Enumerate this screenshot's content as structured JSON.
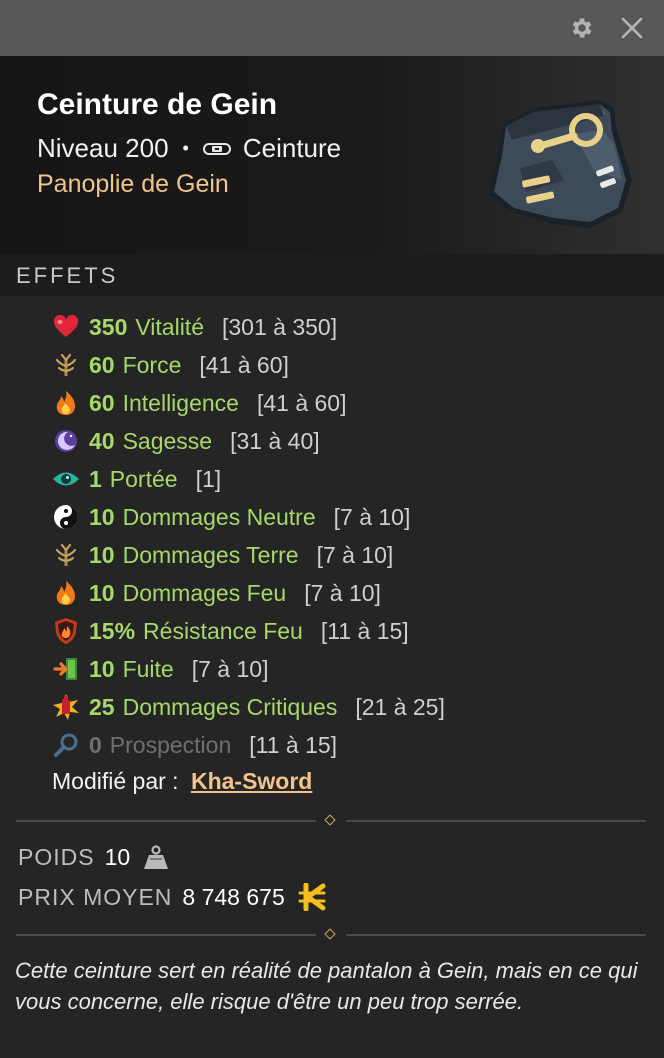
{
  "window": {
    "settings_icon": "gear-icon",
    "close_icon": "close-icon"
  },
  "item": {
    "name": "Ceinture de Gein",
    "level": "Niveau 200",
    "separator": "•",
    "type": "Ceinture",
    "type_icon": "belt-icon",
    "set": "Panoplie de Gein"
  },
  "effects_section": {
    "title": "EFFETS",
    "effects": [
      {
        "icon": "heart-icon",
        "value": "350",
        "name": "Vitalité",
        "range": "[301 à 350]"
      },
      {
        "icon": "earth-sprout-icon",
        "value": "60",
        "name": "Force",
        "range": "[41 à 60]"
      },
      {
        "icon": "fire-icon",
        "value": "60",
        "name": "Intelligence",
        "range": "[41 à 60]"
      },
      {
        "icon": "moon-icon",
        "value": "40",
        "name": "Sagesse",
        "range": "[31 à 40]"
      },
      {
        "icon": "eye-icon",
        "value": "1",
        "name": "Portée",
        "range": "[1]"
      },
      {
        "icon": "yin-yang-icon",
        "value": "10",
        "name": "Dommages Neutre",
        "range": "[7 à 10]"
      },
      {
        "icon": "earth-sprout-icon",
        "value": "10",
        "name": "Dommages Terre",
        "range": "[7 à 10]"
      },
      {
        "icon": "fire-icon",
        "value": "10",
        "name": "Dommages Feu",
        "range": "[7 à 10]"
      },
      {
        "icon": "fire-shield-icon",
        "value": "15%",
        "name": "Résistance Feu",
        "range": "[11 à 15]"
      },
      {
        "icon": "exit-arrow-icon",
        "value": "10",
        "name": "Fuite",
        "range": "[7 à 10]"
      },
      {
        "icon": "critical-burst-icon",
        "value": "25",
        "name": "Dommages Critiques",
        "range": "[21 à 25]"
      },
      {
        "icon": "magnifier-icon",
        "value": "0",
        "name": "Prospection",
        "range": "[11 à 15]"
      }
    ],
    "modified_label": "Modifié par :",
    "modified_by": "Kha-Sword"
  },
  "stats": {
    "weight_label": "POIDS",
    "weight_value": "10",
    "weight_icon": "weight-icon",
    "price_label": "PRIX MOYEN",
    "price_value": "8 748 675",
    "price_icon": "kamas-icon"
  },
  "description": "Cette ceinture sert en réalité de pantalon à Gein, mais en ce qui vous concerne, elle risque d'être un peu trop serrée.",
  "colors": {
    "bonus_green": "#a6d86a",
    "set_gold": "#f2c48c",
    "dim_gray": "#6f6f6f"
  }
}
